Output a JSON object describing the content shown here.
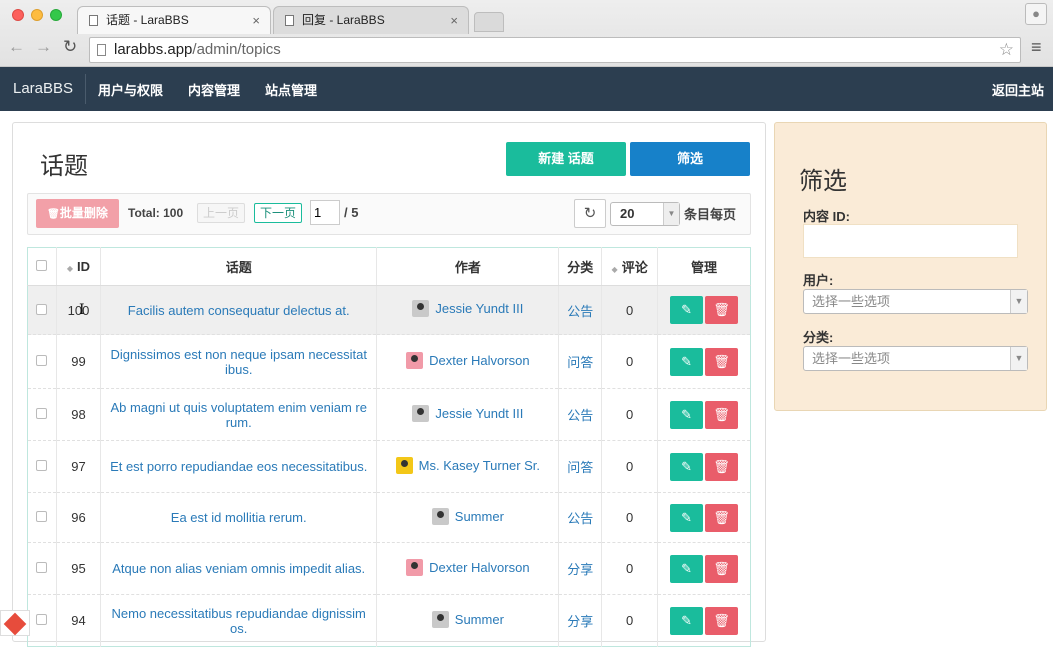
{
  "browser": {
    "tabs": [
      {
        "title": "话题 - LaraBBS"
      },
      {
        "title": "回复 - LaraBBS"
      }
    ],
    "url_host": "larabbs.app",
    "url_path": "/admin/topics"
  },
  "navbar": {
    "brand": "LaraBBS",
    "items": [
      "用户与权限",
      "内容管理",
      "站点管理"
    ],
    "back_link": "返回主站"
  },
  "page": {
    "title": "话题",
    "new_button": "新建 话题",
    "filter_button": "筛选"
  },
  "toolbar": {
    "batch_delete": "批量删除",
    "total": "Total: 100",
    "prev": "上一页",
    "next": "下一页",
    "page_value": "1",
    "page_total": "/ 5",
    "per_page_value": "20",
    "per_page_label": "条目每页"
  },
  "table": {
    "headers": [
      "ID",
      "话题",
      "作者",
      "分类",
      "评论",
      "管理"
    ],
    "rows": [
      {
        "id": "100",
        "title": "Facilis autem consequatur delectus at.",
        "author": "Jessie Yundt III",
        "avatar": "gray",
        "category": "公告",
        "comments": "0"
      },
      {
        "id": "99",
        "title": "Dignissimos est non neque ipsam necessitat ibus.",
        "author": "Dexter Halvorson",
        "avatar": "pink",
        "category": "问答",
        "comments": "0"
      },
      {
        "id": "98",
        "title": "Ab magni ut quis voluptatem enim veniam re rum.",
        "author": "Jessie Yundt III",
        "avatar": "gray",
        "category": "公告",
        "comments": "0"
      },
      {
        "id": "97",
        "title": "Et est porro repudiandae eos necessitatibus.",
        "author": "Ms. Kasey Turner Sr.",
        "avatar": "yellow",
        "category": "问答",
        "comments": "0"
      },
      {
        "id": "96",
        "title": "Ea est id mollitia rerum.",
        "author": "Summer",
        "avatar": "gray",
        "category": "公告",
        "comments": "0"
      },
      {
        "id": "95",
        "title": "Atque non alias veniam omnis impedit alias.",
        "author": "Dexter Halvorson",
        "avatar": "pink",
        "category": "分享",
        "comments": "0"
      },
      {
        "id": "94",
        "title": "Nemo necessitatibus repudiandae dignissim os.",
        "author": "Summer",
        "avatar": "gray",
        "category": "分享",
        "comments": "0"
      }
    ]
  },
  "filter": {
    "title": "筛选",
    "id_label": "内容 ID:",
    "user_label": "用户:",
    "user_placeholder": "选择一些选项",
    "category_label": "分类:",
    "category_placeholder": "选择一些选项"
  },
  "colors": {
    "navbar": "#2c3e50",
    "primary_green": "#1abc9c",
    "primary_blue": "#1781c9",
    "danger": "#e95d6a",
    "link": "#2a7ab8",
    "filter_bg": "#faebd7"
  }
}
